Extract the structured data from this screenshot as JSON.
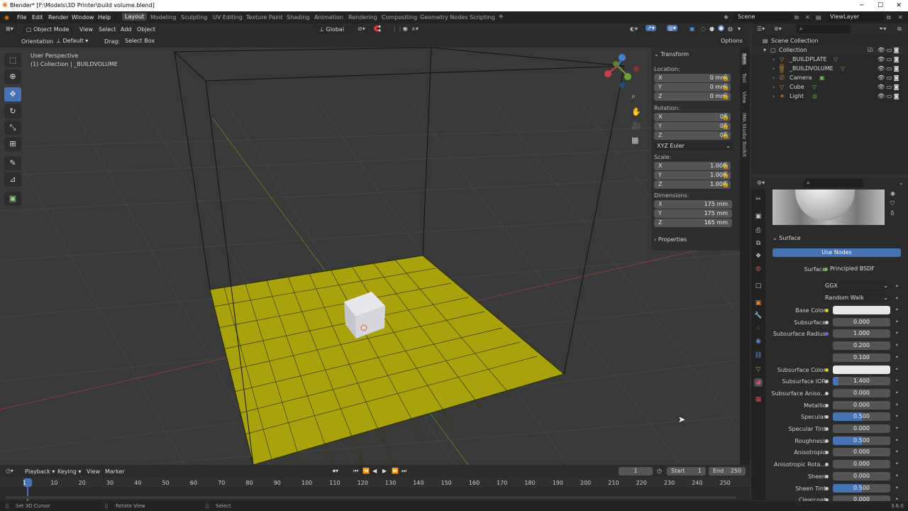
{
  "window": {
    "title": "Blender* [F:\\Models\\3D Printer\\build volume.blend]",
    "minimize": "─",
    "maximize": "☐",
    "close": "✕"
  },
  "menus": [
    "File",
    "Edit",
    "Render",
    "Window",
    "Help"
  ],
  "workspaces": [
    {
      "label": "Layout",
      "active": true
    },
    {
      "label": "Modeling",
      "active": false
    },
    {
      "label": "Sculpting",
      "active": false
    },
    {
      "label": "UV Editing",
      "active": false
    },
    {
      "label": "Texture Paint",
      "active": false
    },
    {
      "label": "Shading",
      "active": false
    },
    {
      "label": "Animation",
      "active": false
    },
    {
      "label": "Rendering",
      "active": false
    },
    {
      "label": "Compositing",
      "active": false
    },
    {
      "label": "Geometry Nodes",
      "active": false
    },
    {
      "label": "Scripting",
      "active": false
    }
  ],
  "add_workspace": "+",
  "scene": {
    "name": "Scene",
    "view_layer": "ViewLayer"
  },
  "viewport_header": {
    "mode": "Object Mode",
    "menus": [
      "View",
      "Select",
      "Add",
      "Object"
    ],
    "transform_orientation": "Global",
    "orientation_label": "Orientation:",
    "orientation_value": "Default",
    "drag_label": "Drag:",
    "drag_value": "Select Box",
    "options": "Options"
  },
  "viewport": {
    "overlay_title": "User Perspective",
    "overlay_subtitle": "(1) Collection | _BUILDVOLUME"
  },
  "tools": [
    {
      "name": "select-box-tool",
      "icon": "⬚",
      "active": false
    },
    {
      "name": "cursor-tool",
      "icon": "⊕",
      "active": false
    },
    {
      "name": "move-tool",
      "icon": "✥",
      "active": true
    },
    {
      "name": "rotate-tool",
      "icon": "↻",
      "active": false
    },
    {
      "name": "scale-tool",
      "icon": "⤡",
      "active": false
    },
    {
      "name": "transform-tool",
      "icon": "⊞",
      "active": false
    },
    {
      "name": "annotate-tool",
      "icon": "✎",
      "active": false
    },
    {
      "name": "measure-tool",
      "icon": "📐",
      "active": false
    },
    {
      "name": "add-cube-tool",
      "icon": "▣",
      "active": false
    }
  ],
  "n_panel": {
    "transform_label": "Transform",
    "location_label": "Location:",
    "location": [
      {
        "axis": "X",
        "value": "0 mm"
      },
      {
        "axis": "Y",
        "value": "0 mm"
      },
      {
        "axis": "Z",
        "value": "0 mm"
      }
    ],
    "rotation_label": "Rotation:",
    "rotation": [
      {
        "axis": "X",
        "value": "0°"
      },
      {
        "axis": "Y",
        "value": "0°"
      },
      {
        "axis": "Z",
        "value": "0°"
      }
    ],
    "rotation_mode": "XYZ Euler",
    "scale_label": "Scale:",
    "scale": [
      {
        "axis": "X",
        "value": "1.000"
      },
      {
        "axis": "Y",
        "value": "1.000"
      },
      {
        "axis": "Z",
        "value": "1.000"
      }
    ],
    "dimensions_label": "Dimensions:",
    "dimensions": [
      {
        "axis": "X",
        "value": "175 mm"
      },
      {
        "axis": "Y",
        "value": "175 mm"
      },
      {
        "axis": "Z",
        "value": "165 mm"
      }
    ],
    "properties_label": "Properties",
    "tabs": [
      "Item",
      "Tool",
      "View",
      "IMA Studio Toolkit"
    ]
  },
  "outliner": {
    "search_placeholder": "",
    "rows": [
      {
        "label": "Scene Collection",
        "indent": 0
      },
      {
        "label": "Collection",
        "indent": 1
      },
      {
        "label": "_BUILDPLATE",
        "indent": 2
      },
      {
        "label": "_BUILDVOLUME",
        "indent": 2
      },
      {
        "label": "Camera",
        "indent": 2
      },
      {
        "label": "Cube",
        "indent": 2
      },
      {
        "label": "Light",
        "indent": 2
      }
    ]
  },
  "properties": {
    "surface_panel": "Surface",
    "use_nodes": "Use Nodes",
    "surface_label": "Surface",
    "surface_value": "Principled BSDF",
    "distribution": "GGX",
    "subsurface_method": "Random Walk",
    "fields": [
      {
        "label": "Base Color",
        "value": "",
        "kind": "color",
        "dot": "y",
        "fill": 0
      },
      {
        "label": "Subsurface",
        "value": "0.000",
        "kind": "num",
        "dot": "g",
        "fill": 0
      },
      {
        "label": "Subsurface Radius",
        "value": "1.000",
        "kind": "num",
        "dot": "p",
        "fill": 0
      },
      {
        "label": "",
        "value": "0.200",
        "kind": "num",
        "dot": "",
        "fill": 0
      },
      {
        "label": "",
        "value": "0.100",
        "kind": "num",
        "dot": "",
        "fill": 0
      },
      {
        "label": "Subsurface Color",
        "value": "",
        "kind": "color",
        "dot": "y",
        "fill": 0
      },
      {
        "label": "Subsurface IOR",
        "value": "1.400",
        "kind": "num",
        "dot": "g",
        "fill": 0.1
      },
      {
        "label": "Subsurface Aniso...",
        "value": "0.000",
        "kind": "num",
        "dot": "g",
        "fill": 0
      },
      {
        "label": "Metallic",
        "value": "0.000",
        "kind": "num",
        "dot": "g",
        "fill": 0
      },
      {
        "label": "Specular",
        "value": "0.500",
        "kind": "num",
        "dot": "g",
        "fill": 0.5
      },
      {
        "label": "Specular Tint",
        "value": "0.000",
        "kind": "num",
        "dot": "g",
        "fill": 0
      },
      {
        "label": "Roughness",
        "value": "0.500",
        "kind": "num",
        "dot": "g",
        "fill": 0.5
      },
      {
        "label": "Anisotropic",
        "value": "0.000",
        "kind": "num",
        "dot": "g",
        "fill": 0
      },
      {
        "label": "Anisotropic Rota...",
        "value": "0.000",
        "kind": "num",
        "dot": "g",
        "fill": 0
      },
      {
        "label": "Sheen",
        "value": "0.000",
        "kind": "num",
        "dot": "g",
        "fill": 0
      },
      {
        "label": "Sheen Tint",
        "value": "0.500",
        "kind": "num",
        "dot": "g",
        "fill": 0.5
      },
      {
        "label": "Clearcoat",
        "value": "0.000",
        "kind": "num",
        "dot": "g",
        "fill": 0
      }
    ]
  },
  "timeline": {
    "menus": [
      "Playback",
      "Keying",
      "View",
      "Marker"
    ],
    "current_frame": "1",
    "start_label": "Start",
    "start": "1",
    "end_label": "End",
    "end": "250",
    "ticks": [
      "1",
      "10",
      "20",
      "30",
      "40",
      "50",
      "60",
      "70",
      "80",
      "90",
      "100",
      "110",
      "120",
      "130",
      "140",
      "150",
      "160",
      "170",
      "180",
      "190",
      "200",
      "210",
      "220",
      "230",
      "240",
      "250"
    ]
  },
  "statusbar": {
    "left": "Set 3D Cursor",
    "middle": "Rotate View",
    "right": "Select",
    "version": "3.6.0"
  },
  "colors": {
    "accent": "#4772b3",
    "plate": "#a8a20c",
    "background": "#393939"
  }
}
